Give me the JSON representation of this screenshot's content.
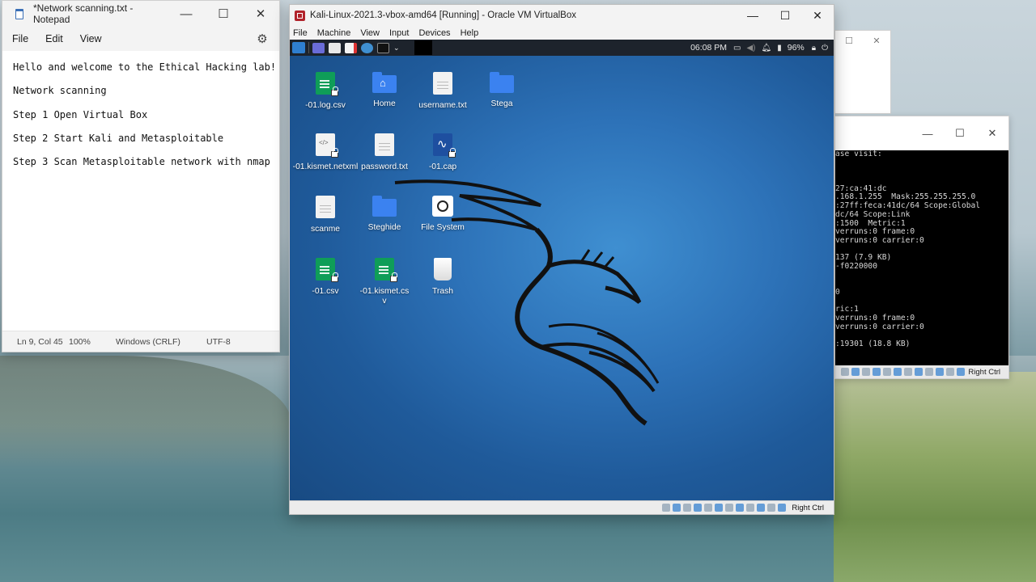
{
  "notepad": {
    "title": "*Network scanning.txt - Notepad",
    "menu": [
      "File",
      "Edit",
      "View"
    ],
    "lines": [
      "Hello and welcome to the Ethical Hacking lab!",
      "Network scanning",
      "Step 1 Open Virtual Box",
      "Step 2 Start Kali and Metasploitable",
      "Step 3 Scan Metasploitable network with nmap"
    ],
    "status": {
      "position": "Ln 9, Col 45",
      "zoom": "100%",
      "line_ending": "Windows (CRLF)",
      "encoding": "UTF-8"
    }
  },
  "vbox": {
    "title": "Kali-Linux-2021.3-vbox-amd64 [Running] - Oracle VM VirtualBox",
    "menu": [
      "File",
      "Machine",
      "View",
      "Input",
      "Devices",
      "Help"
    ],
    "host_key": "Right Ctrl"
  },
  "kali": {
    "time": "06:08 PM",
    "battery": "96%",
    "icons": [
      {
        "label": "-01.log.csv"
      },
      {
        "label": "Home"
      },
      {
        "label": "username.txt"
      },
      {
        "label": "Stega"
      },
      {
        "label": "-01.kismet.netxml"
      },
      {
        "label": "password.txt"
      },
      {
        "label": "-01.cap"
      },
      {
        "label": "scanme"
      },
      {
        "label": "Steghide"
      },
      {
        "label": "File System"
      },
      {
        "label": "-01.csv"
      },
      {
        "label": "-01.kismet.csv"
      },
      {
        "label": "Trash"
      }
    ]
  },
  "terminal": {
    "lines": [
      "ase visit:",
      "",
      "",
      "",
      "27:ca:41:dc",
      ".168.1.255  Mask:255.255.255.0",
      ":27ff:feca:41dc/64 Scope:Global",
      "dc/64 Scope:Link",
      ":1500  Metric:1",
      "verruns:0 frame:0",
      "verruns:0 carrier:0",
      "",
      "137 (7.9 KB)",
      "-f0220000",
      "",
      "",
      "0",
      "",
      "ric:1",
      "verruns:0 frame:0",
      "verruns:0 carrier:0",
      "",
      ":19301 (18.8 KB)"
    ],
    "host_key": "Right Ctrl"
  }
}
